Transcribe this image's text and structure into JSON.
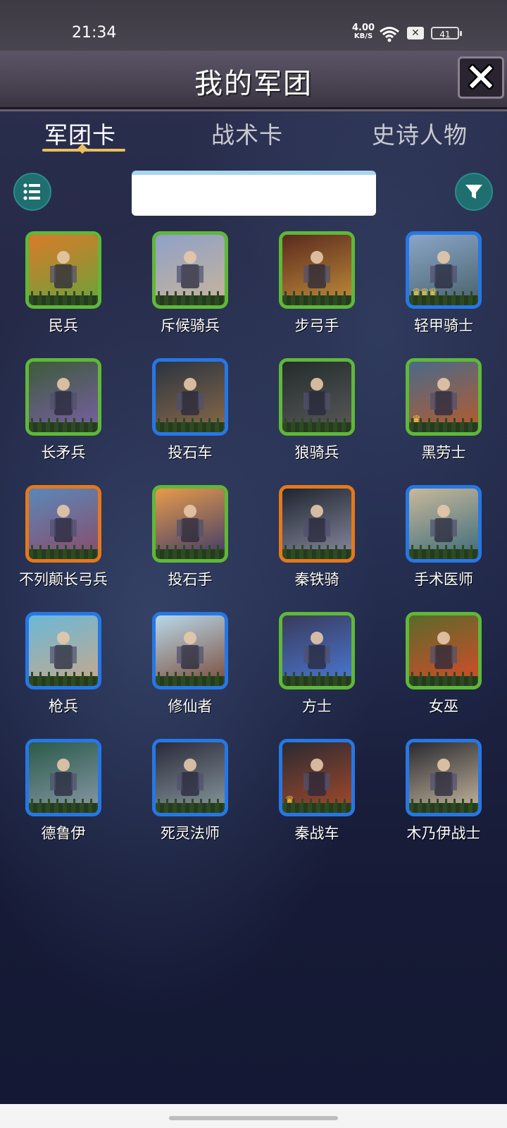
{
  "status": {
    "time": "21:34",
    "speed_value": "4.00",
    "speed_unit": "KB/S",
    "battery": "41"
  },
  "header": {
    "title": "我的军团"
  },
  "tabs": [
    {
      "label": "军团卡",
      "active": true
    },
    {
      "label": "战术卡",
      "active": false
    },
    {
      "label": "史诗人物",
      "active": false
    }
  ],
  "search": {
    "value": "",
    "placeholder": ""
  },
  "cards": [
    {
      "name": "民兵",
      "rarity": "green",
      "crowns": 0,
      "bg": [
        "#d97a2a",
        "#6aa33a"
      ]
    },
    {
      "name": "斥候骑兵",
      "rarity": "green",
      "crowns": 0,
      "bg": [
        "#8fa0c8",
        "#c9b59a"
      ]
    },
    {
      "name": "步弓手",
      "rarity": "green",
      "crowns": 0,
      "bg": [
        "#5a2a1e",
        "#c28d3a"
      ]
    },
    {
      "name": "轻甲骑士",
      "rarity": "blue",
      "crowns": 3,
      "bg": [
        "#8aa6c8",
        "#48606a"
      ]
    },
    {
      "name": "长矛兵",
      "rarity": "green",
      "crowns": 0,
      "bg": [
        "#3d5c3a",
        "#7a5ea8"
      ]
    },
    {
      "name": "投石车",
      "rarity": "blue",
      "crowns": 0,
      "bg": [
        "#2b3440",
        "#8a6a4a"
      ]
    },
    {
      "name": "狼骑兵",
      "rarity": "green",
      "crowns": 0,
      "bg": [
        "#232c2c",
        "#5a5a5a"
      ]
    },
    {
      "name": "黑劳士",
      "rarity": "green",
      "crowns": 1,
      "bg": [
        "#4a6a8a",
        "#b85a2a"
      ]
    },
    {
      "name": "不列颠长弓兵",
      "rarity": "orange",
      "crowns": 0,
      "bg": [
        "#5a88b8",
        "#8a4a6a"
      ]
    },
    {
      "name": "投石手",
      "rarity": "green",
      "crowns": 0,
      "bg": [
        "#e89a4a",
        "#3a3a6a"
      ]
    },
    {
      "name": "秦铁骑",
      "rarity": "orange",
      "crowns": 0,
      "bg": [
        "#1e2630",
        "#8a8aa0"
      ]
    },
    {
      "name": "手术医师",
      "rarity": "blue",
      "crowns": 0,
      "bg": [
        "#c8b89a",
        "#3a6a7a"
      ]
    },
    {
      "name": "枪兵",
      "rarity": "blue",
      "crowns": 0,
      "bg": [
        "#6ab8d8",
        "#c8a88a"
      ]
    },
    {
      "name": "修仙者",
      "rarity": "blue",
      "crowns": 0,
      "bg": [
        "#b8d8e8",
        "#7a4a3a"
      ]
    },
    {
      "name": "方士",
      "rarity": "green",
      "crowns": 0,
      "bg": [
        "#3a3a5a",
        "#4a7ad8"
      ]
    },
    {
      "name": "女巫",
      "rarity": "green",
      "crowns": 0,
      "bg": [
        "#5a6a2a",
        "#d84a2a"
      ]
    },
    {
      "name": "德鲁伊",
      "rarity": "blue",
      "crowns": 0,
      "bg": [
        "#2a5a4a",
        "#8a9aa8"
      ]
    },
    {
      "name": "死灵法师",
      "rarity": "blue",
      "crowns": 0,
      "bg": [
        "#2a2a3a",
        "#8a9aa0"
      ]
    },
    {
      "name": "秦战车",
      "rarity": "blue",
      "crowns": 1,
      "bg": [
        "#2a2a32",
        "#a84a2a"
      ]
    },
    {
      "name": "木乃伊战士",
      "rarity": "blue",
      "crowns": 0,
      "bg": [
        "#2a2a30",
        "#c8b8a0"
      ]
    }
  ],
  "colors": {
    "green": "#5fb838",
    "blue": "#2677e6",
    "orange": "#e5781c",
    "accent": "#e8c15b",
    "teal": "#1f6e70"
  }
}
